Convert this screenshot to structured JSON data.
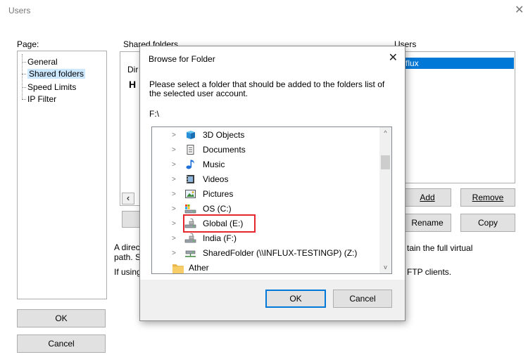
{
  "window": {
    "title": "Users",
    "close_glyph": "✕"
  },
  "page_panel": {
    "label": "Page:",
    "items": [
      "General",
      "Shared folders",
      "Speed Limits",
      "IP Filter"
    ],
    "selected_index": 1
  },
  "shared_folders": {
    "label": "Shared folders",
    "partial_column": "Dir",
    "partial_value": "H",
    "scroll_left_glyph": "‹",
    "desc_line1": "A direc",
    "desc_line1_right": "tain the full virtual",
    "desc_line2": "path. S",
    "desc_line3": "If using",
    "desc_line3_right": "FTP clients."
  },
  "users_panel": {
    "label": "Users",
    "selected_user": "flux",
    "add_label": "Add",
    "remove_label": "Remove",
    "rename_label": "Rename",
    "copy_label": "Copy"
  },
  "footer": {
    "ok_label": "OK",
    "cancel_label": "Cancel"
  },
  "browse": {
    "title": "Browse for Folder",
    "close_glyph": "✕",
    "description": "Please select a folder that should be added to the folders list of the selected user account.",
    "path": "F:\\",
    "chevron": ">",
    "scroll_up": "^",
    "scroll_down": "v",
    "items": [
      {
        "label": "3D Objects",
        "icon": "3d-objects-icon"
      },
      {
        "label": "Documents",
        "icon": "documents-icon"
      },
      {
        "label": "Music",
        "icon": "music-icon"
      },
      {
        "label": "Videos",
        "icon": "videos-icon"
      },
      {
        "label": "Pictures",
        "icon": "pictures-icon"
      },
      {
        "label": "OS (C:)",
        "icon": "drive-icon"
      },
      {
        "label": "Global (E:)",
        "icon": "drive-icon"
      },
      {
        "label": "India (F:)",
        "icon": "drive-icon"
      },
      {
        "label": "SharedFolder (\\\\INFLUX-TESTINGP) (Z:)",
        "icon": "network-drive-icon"
      },
      {
        "label": "Ather",
        "icon": "folder-icon"
      }
    ],
    "ok_label": "OK",
    "cancel_label": "Cancel"
  },
  "colors": {
    "highlight": "#e8262f",
    "selection": "#cce8ff",
    "accent": "#0078d7"
  }
}
